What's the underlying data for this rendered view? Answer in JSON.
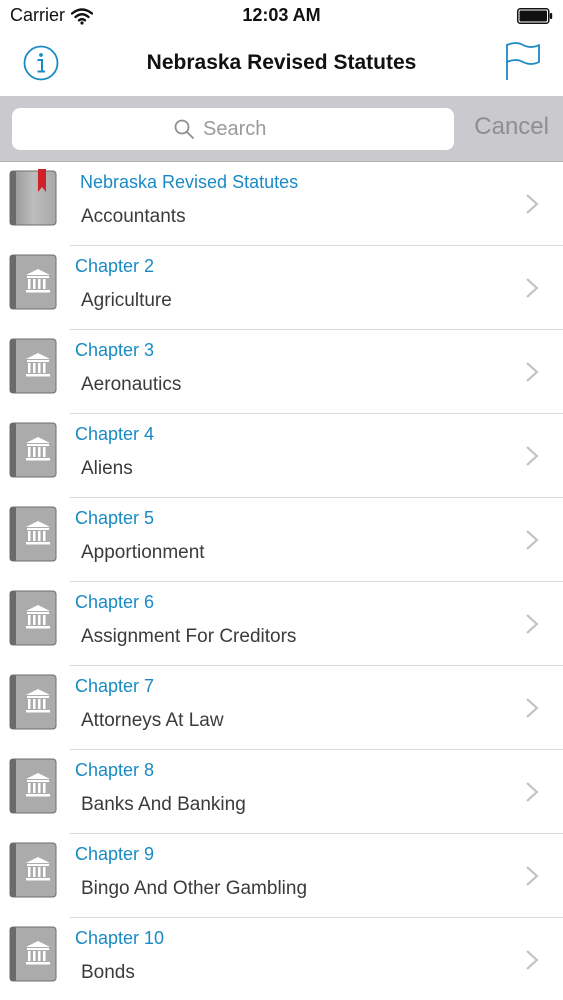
{
  "status_bar": {
    "carrier": "Carrier",
    "time": "12:03 AM"
  },
  "nav": {
    "title": "Nebraska Revised Statutes",
    "info_icon": "info-icon",
    "flag_icon": "flag-icon"
  },
  "search": {
    "placeholder": "Search",
    "cancel_label": "Cancel"
  },
  "colors": {
    "accent": "#1a8ac4",
    "bookmark": "#d0202a",
    "search_bar_bg": "#c9c9ce"
  },
  "list": {
    "items": [
      {
        "chapter": "Nebraska Revised Statutes",
        "title": "Accountants",
        "icon": "bookmark-book-icon"
      },
      {
        "chapter": "Chapter 2",
        "title": "Agriculture",
        "icon": "courthouse-book-icon"
      },
      {
        "chapter": "Chapter 3",
        "title": "Aeronautics",
        "icon": "courthouse-book-icon"
      },
      {
        "chapter": "Chapter 4",
        "title": "Aliens",
        "icon": "courthouse-book-icon"
      },
      {
        "chapter": "Chapter 5",
        "title": "Apportionment",
        "icon": "courthouse-book-icon"
      },
      {
        "chapter": "Chapter 6",
        "title": "Assignment For Creditors",
        "icon": "courthouse-book-icon"
      },
      {
        "chapter": "Chapter 7",
        "title": "Attorneys At Law",
        "icon": "courthouse-book-icon"
      },
      {
        "chapter": "Chapter 8",
        "title": "Banks And Banking",
        "icon": "courthouse-book-icon"
      },
      {
        "chapter": "Chapter 9",
        "title": "Bingo And Other Gambling",
        "icon": "courthouse-book-icon"
      },
      {
        "chapter": "Chapter 10",
        "title": "Bonds",
        "icon": "courthouse-book-icon"
      }
    ]
  }
}
